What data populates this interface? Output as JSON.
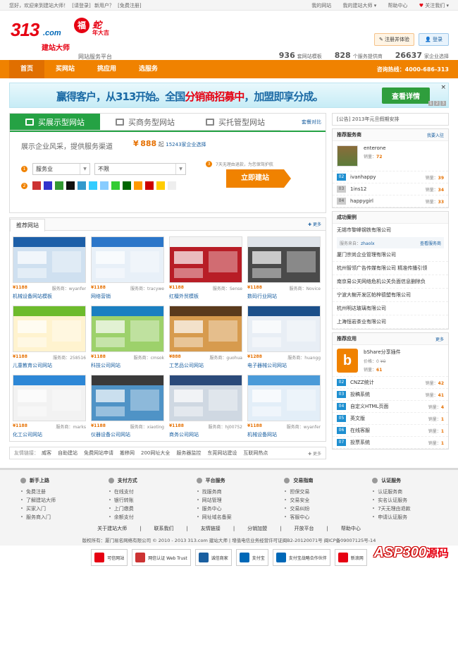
{
  "topbar": {
    "welcome": "您好，欢迎来到建站大师！",
    "login": "[请登录]",
    "new_user": "新用户？",
    "register": "[免费注册]",
    "my_site": "我的网站",
    "my_master": "我的建站大师",
    "help": "帮助中心",
    "follow": "关注我们"
  },
  "logo": {
    "num": "313",
    "com": ".com",
    "brand": "建站大师",
    "fu": "福",
    "she": "蛇",
    "nian": "年大吉",
    "slogan": "网站服务平台"
  },
  "header": {
    "reg_btn": "注册并体验",
    "login_btn": "登录"
  },
  "stats": [
    {
      "num": "936",
      "label": "套网站模板"
    },
    {
      "num": "828",
      "label": "个服务提供商"
    },
    {
      "num": "26637",
      "label": "家企业选择"
    }
  ],
  "nav": {
    "items": [
      "首页",
      "买网站",
      "挑应用",
      "选服务"
    ],
    "hotline": "咨询热线：4000-686-313"
  },
  "banner": {
    "text_a": "赢得客户，从313开始。全国",
    "text_b": "分销商招募中",
    "text_c": "，加盟即享分成。",
    "button": "查看详情",
    "close": "×",
    "pages": [
      "1",
      "2",
      "3"
    ]
  },
  "tabs": {
    "items": [
      "买展示型网站",
      "买商务型网站",
      "买托管型网站"
    ],
    "compare": "套餐对比"
  },
  "panel": {
    "title": "展示企业风采，提供服务渠道",
    "price_sym": "¥",
    "price": "888",
    "price_from": "起",
    "chosen": "15243家企业选择",
    "sel1": "服务业",
    "sel2": "不限",
    "guarantee": "7天无理由退款，为您保驾护航",
    "build": "立即建站",
    "colors": [
      "#c33",
      "#33c",
      "#393",
      "#111",
      "#39c",
      "#3cf",
      "#8cf",
      "#3c3",
      "#060",
      "#f90",
      "#c00",
      "#fc0",
      "#eee"
    ]
  },
  "recommended": {
    "title": "推荐网站",
    "more": "更多",
    "items": [
      {
        "price": "¥1188",
        "svc": "服务商：wyanfer",
        "name": "机械设备网站模板",
        "c1": "#1d5fa8",
        "c2": "#cfe0f0"
      },
      {
        "price": "¥1188",
        "svc": "服务商：tracywe",
        "name": "网络营销",
        "c1": "#2b76c9",
        "c2": "#e8f0f8"
      },
      {
        "price": "¥1188",
        "svc": "服务商：Sense",
        "name": "红檀外贸模板",
        "c1": "#f4f4f4",
        "c2": "#b81d26"
      },
      {
        "price": "¥1188",
        "svc": "服务商：Novice",
        "name": "数码行业网站",
        "c1": "#dfe4ea",
        "c2": "#4a4a4a"
      },
      {
        "price": "¥1188",
        "svc": "服务商：258516",
        "name": "儿童教育公司网站",
        "c1": "#6dbb2c",
        "c2": "#fff3cf"
      },
      {
        "price": "¥1188",
        "svc": "服务商：cmsok",
        "name": "科技公司网站",
        "c1": "#1a7fc1",
        "c2": "#9dd16b"
      },
      {
        "price": "¥888",
        "svc": "服务商：guohua",
        "name": "工艺品公司网站",
        "c1": "#5a3a1c",
        "c2": "#d79b4e"
      },
      {
        "price": "¥1288",
        "svc": "服务商：huangg",
        "name": "电子器械公司网站",
        "c1": "#1b4f8a",
        "c2": "#e8eef5"
      },
      {
        "price": "¥1188",
        "svc": "服务商：marks",
        "name": "化工公司网站",
        "c1": "#2d87d6",
        "c2": "#f2f2f2"
      },
      {
        "price": "¥1188",
        "svc": "服务商：xiaoting",
        "name": "仪器设备公司网站",
        "c1": "#3a3a3a",
        "c2": "#4f93c6"
      },
      {
        "price": "¥1188",
        "svc": "服务商：hj00752",
        "name": "商务公司网站",
        "c1": "#2b4a7a",
        "c2": "#cfd8e2"
      },
      {
        "price": "¥1188",
        "svc": "服务商：wyanfer",
        "name": "机械设备网站",
        "c1": "#4a9ad8",
        "c2": "#e3eef8"
      }
    ]
  },
  "friendlinks": {
    "label": "友情链接：",
    "items": [
      "威客",
      "自助建站",
      "免费网站申请",
      "搬移网",
      "200网址大全",
      "服务器监控",
      "东莞网站建设",
      "互联网热点"
    ],
    "more": "更多"
  },
  "notice": "[公告] 2013年元旦假期安排",
  "providers": {
    "title": "推荐服务商",
    "more": "我要入驻",
    "top": {
      "name": "enterone",
      "sales_label": "销量：",
      "sales": "72"
    },
    "list": [
      {
        "rank": "02",
        "name": "ivanhappy",
        "sales": "39"
      },
      {
        "rank": "03",
        "name": "1ins12",
        "sales": "34"
      },
      {
        "rank": "04",
        "name": "happygirl",
        "sales": "33"
      }
    ],
    "sales_label": "销量："
  },
  "cases": {
    "title": "成功案例",
    "first": "无锡市黎峰钢铁有限公司",
    "src_label": "服务来自：",
    "src_name": "zhaolx",
    "src_link": "查看服务商",
    "items": [
      "厦门宗尚企业管理有限公司",
      "杭州智领广告传媒有限公司 精准传播引领",
      "南京易公关网络危机公关负面信息删除负",
      "宁波大榭开发区帕梓德塑有限公司",
      "杭州明达玻璃有限公司",
      "上海恒岩茶业有限公司"
    ]
  },
  "apps": {
    "title": "推荐应用",
    "more": "更多",
    "top": {
      "icon": "b",
      "name": "bShare分享插件",
      "price_label": "价格：",
      "price": "0",
      "old": "¥0",
      "sales_label": "销量：",
      "sales": "61"
    },
    "list": [
      {
        "rank": "02",
        "name": "CNZZ统计",
        "sales": "42"
      },
      {
        "rank": "03",
        "name": "投稿系统",
        "sales": "41"
      },
      {
        "rank": "04",
        "name": "自定义HTML页面",
        "sales": "4"
      },
      {
        "rank": "05",
        "name": "英文版",
        "sales": "1"
      },
      {
        "rank": "06",
        "name": "在线客服",
        "sales": "1"
      },
      {
        "rank": "07",
        "name": "投票系统",
        "sales": "1"
      }
    ],
    "sales_label": "销量："
  },
  "footer": {
    "cols": [
      {
        "title": "新手上路",
        "items": [
          "免费注册",
          "了解建站大师",
          "买家入门",
          "服务商入门"
        ]
      },
      {
        "title": "支付方式",
        "items": [
          "在线支付",
          "银行转账",
          "上门缴费",
          "余额支付"
        ]
      },
      {
        "title": "平台服务",
        "items": [
          "找服务商",
          "网站管理",
          "服务中心",
          "网址域名备案"
        ]
      },
      {
        "title": "交易指南",
        "items": [
          "担保交易",
          "交易安全",
          "交易纠纷",
          "客服中心"
        ]
      },
      {
        "title": "认证服务",
        "items": [
          "认证服务商",
          "实名认证服务",
          "7天无理由退款",
          "申请认证服务"
        ]
      }
    ],
    "links": [
      "关于建站大师",
      "联系我们",
      "友情链接",
      "分销加盟",
      "开放平台",
      "帮助中心"
    ],
    "copyright": "版权所有：厦门易名网络有限公司 © 2010 - 2013 313.com 建站大师 | 增值电信业务经营许可证闽B2-20120071号 闽ICP备09007125号-14",
    "badges": [
      "可信网站",
      "网信认证 Web Trust",
      "诚信商家",
      "支付宝",
      "支付宝战略合作伙伴",
      "新浪网"
    ],
    "asp": "ASP300",
    "asp2": "源码"
  }
}
